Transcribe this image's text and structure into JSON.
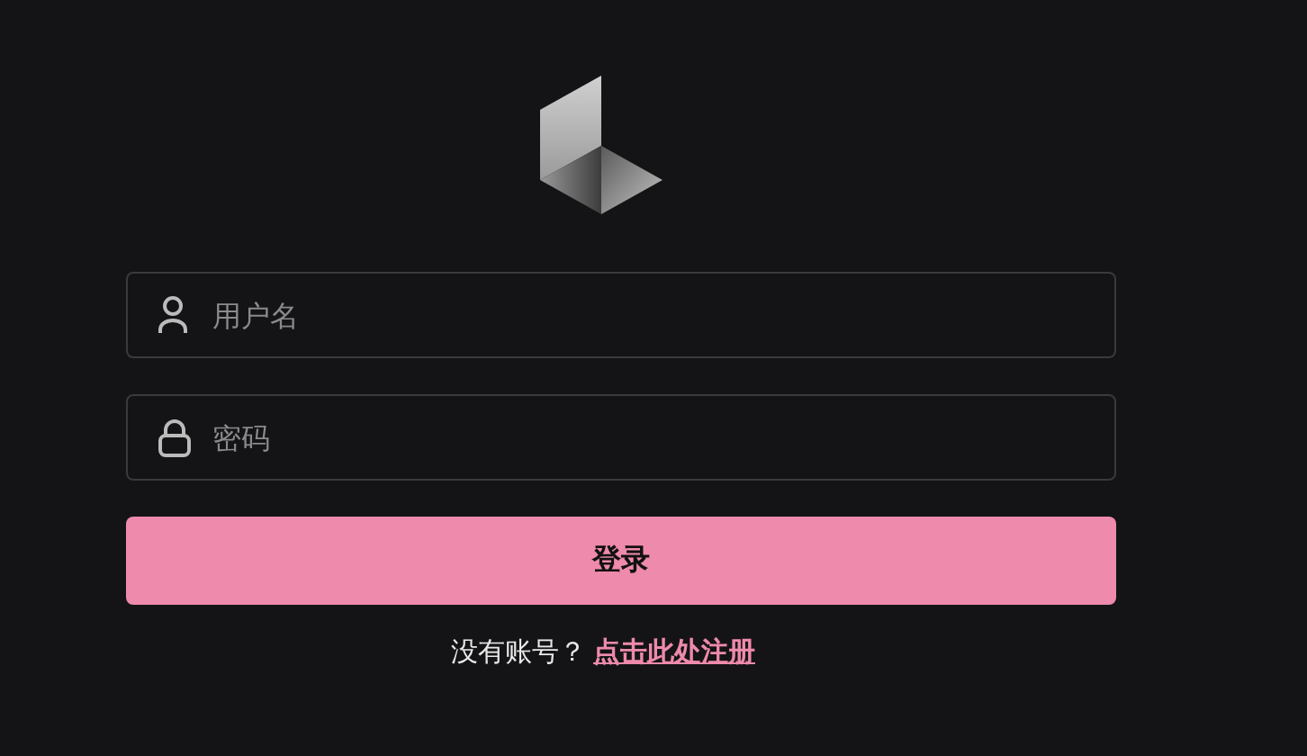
{
  "username_field": {
    "placeholder": "用户名"
  },
  "password_field": {
    "placeholder": "密码"
  },
  "login_button": {
    "label": "登录"
  },
  "register_prompt": {
    "text": "没有账号？",
    "link": "点击此处注册"
  }
}
